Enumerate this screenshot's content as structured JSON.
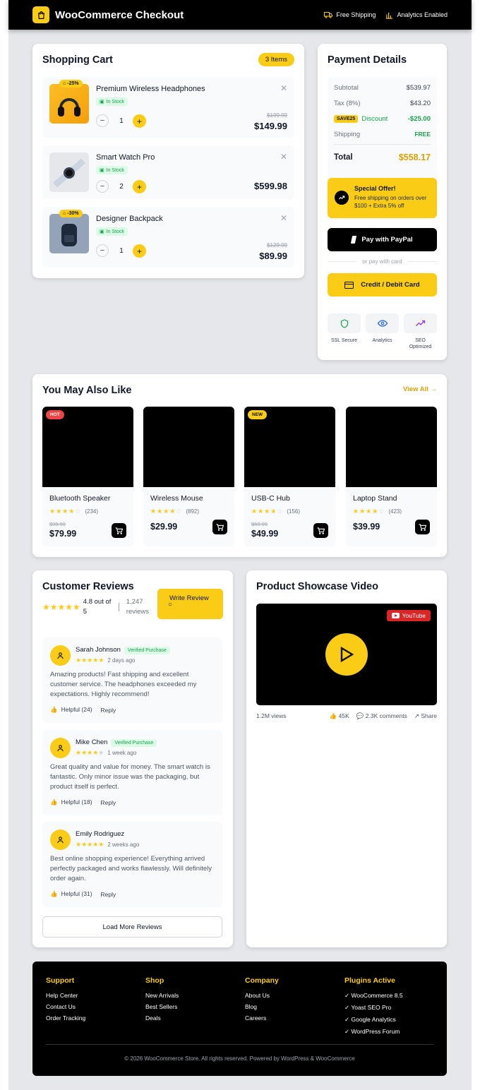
{
  "header": {
    "title": "WooCommerce Checkout",
    "badges": [
      "Free Shipping",
      "Analytics Enabled"
    ]
  },
  "cart": {
    "title": "Shopping Cart",
    "count": "3 Items",
    "items": [
      {
        "name": "Premium Wireless Headphones",
        "discount": "-25%",
        "stock": "In Stock",
        "qty": "1",
        "old_price": "$199.99",
        "price": "$149.99"
      },
      {
        "name": "Smart Watch Pro",
        "discount": "",
        "stock": "In Stock",
        "qty": "2",
        "old_price": "",
        "price": "$599.98"
      },
      {
        "name": "Designer Backpack",
        "discount": "-30%",
        "stock": "In Stock",
        "qty": "1",
        "old_price": "$129.99",
        "price": "$89.99"
      }
    ]
  },
  "payment": {
    "title": "Payment Details",
    "subtotal_label": "Subtotal",
    "subtotal": "$539.97",
    "tax_label": "Tax (8%)",
    "tax": "$43.20",
    "coupon": "SAVE25",
    "discount_label": "Discount",
    "discount": "-$25.00",
    "shipping_label": "Shipping",
    "shipping": "FREE",
    "total_label": "Total",
    "total": "$558.17",
    "offer_title": "Special Offer!",
    "offer_text": "Free shipping on orders over $100 + Extra 5% off",
    "paypal": "Pay with PayPal",
    "or": "or pay with card",
    "card": "Credit / Debit Card",
    "features": [
      "SSL Secure",
      "Analytics",
      "SEO Optimized"
    ]
  },
  "related": {
    "title": "You May Also Like",
    "view_all": "View All →",
    "products": [
      {
        "name": "Bluetooth Speaker",
        "tag": "HOT",
        "tag_color": "#ef4444",
        "rating": 4,
        "reviews": "(234)",
        "old_price": "$99.99",
        "price": "$79.99"
      },
      {
        "name": "Wireless Mouse",
        "tag": "",
        "rating": 4,
        "reviews": "(892)",
        "old_price": "",
        "price": "$29.99"
      },
      {
        "name": "USB-C Hub",
        "tag": "NEW",
        "tag_color": "#facc15",
        "rating": 4,
        "reviews": "(156)",
        "old_price": "$69.99",
        "price": "$49.99"
      },
      {
        "name": "Laptop Stand",
        "tag": "",
        "rating": 4,
        "reviews": "(423)",
        "old_price": "",
        "price": "$39.99"
      }
    ]
  },
  "reviews": {
    "title": "Customer Reviews",
    "score": "4.8 out of 5",
    "count": "1,247 reviews",
    "write": "Write Review",
    "verified": "Verified Purchase",
    "load_more": "Load More Reviews",
    "reply": "Reply",
    "items": [
      {
        "name": "Sarah Johnson",
        "stars": 5,
        "time": "2 days ago",
        "text": "Amazing products! Fast shipping and excellent customer service. The headphones exceeded my expectations. Highly recommend!",
        "helpful": "Helpful (24)"
      },
      {
        "name": "Mike Chen",
        "stars": 4,
        "time": "1 week ago",
        "text": "Great quality and value for money. The smart watch is fantastic. Only minor issue was the packaging, but product itself is perfect.",
        "helpful": "Helpful (18)"
      },
      {
        "name": "Emily Rodriguez",
        "stars": 5,
        "time": "2 weeks ago",
        "text": "Best online shopping experience! Everything arrived perfectly packaged and works flawlessly. Will definitely order again.",
        "helpful": "Helpful (31)"
      }
    ]
  },
  "video": {
    "title": "Product Showcase Video",
    "badge": "YouTube",
    "views": "1.2M views",
    "likes": "45K",
    "comments": "2.3K comments",
    "share": "Share"
  },
  "footer": {
    "cols": [
      {
        "title": "Support",
        "links": [
          "Help Center",
          "Contact Us",
          "Order Tracking"
        ]
      },
      {
        "title": "Shop",
        "links": [
          "New Arrivals",
          "Best Sellers",
          "Deals"
        ]
      },
      {
        "title": "Company",
        "links": [
          "About Us",
          "Blog",
          "Careers"
        ]
      },
      {
        "title": "Plugins Active",
        "links": [
          "✓ WooCommerce 8.5",
          "✓ Yoast SEO Pro",
          "✓ Google Analytics",
          "✓ WordPress Forum"
        ]
      }
    ],
    "copyright": "© 2026 WooCommerce Store. All rights reserved. Powered by WordPress & WooCommerce"
  }
}
